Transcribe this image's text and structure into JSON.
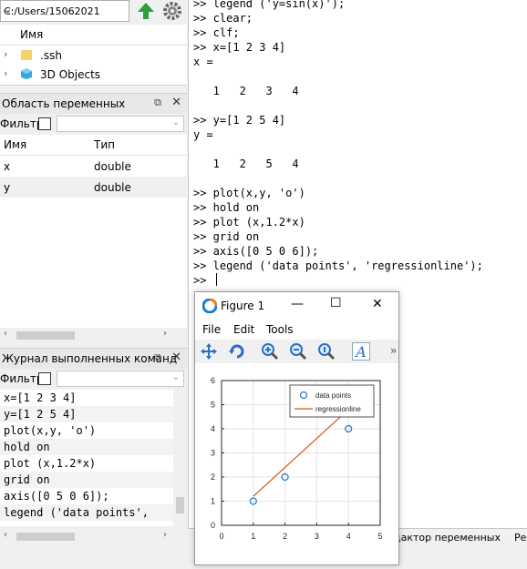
{
  "current_folder": {
    "path": "C:/Users/15062021"
  },
  "files": {
    "header_name": "Имя",
    "items": [
      {
        "name": ".ssh",
        "icon": "folder-icon"
      },
      {
        "name": "3D Objects",
        "icon": "3d-objects-icon"
      }
    ]
  },
  "workspace": {
    "title": "Область переменных",
    "filter_label": "Фильтр",
    "col_name": "Имя",
    "col_type": "Тип",
    "rows": [
      {
        "name": "x",
        "type": "double"
      },
      {
        "name": "y",
        "type": "double"
      }
    ]
  },
  "history": {
    "title": "Журнал выполненных команд",
    "filter_label": "Фильтр",
    "lines": [
      "x=[1 2 3 4]",
      "y=[1 2 5 4]",
      "plot(x,y, 'o')",
      "hold on",
      "plot (x,1.2*x)",
      "grid on",
      "axis([0 5 0 6]);",
      "legend ('data points',"
    ]
  },
  "command_window": {
    "lines": [
      ">> legend ('y=sin(x)');",
      ">> clear;",
      ">> clf;",
      ">> x=[1 2 3 4]",
      "x =",
      "",
      "   1   2   3   4",
      "",
      ">> y=[1 2 5 4]",
      "y =",
      "",
      "   1   2   5   4",
      "",
      ">> plot(x,y, 'o')",
      ">> hold on",
      ">> plot (x,1.2*x)",
      ">> grid on",
      ">> axis([0 5 0 6]);",
      ">> legend ('data points', 'regressionline');",
      ">> "
    ]
  },
  "bottom_tabs": {
    "variable_editor": "дактор переменных",
    "next": "Ре"
  },
  "figure": {
    "title": "Figure 1",
    "menu": [
      "File",
      "Edit",
      "Tools"
    ],
    "toolbar_more": "»",
    "colors": {
      "points": "#1f77d4",
      "line": "#d95319"
    }
  },
  "chart_data": {
    "type": "scatter",
    "x_ticks": [
      "0",
      "1",
      "2",
      "3",
      "4",
      "5"
    ],
    "y_ticks": [
      "0",
      "1",
      "2",
      "3",
      "4",
      "5",
      "6"
    ],
    "xlim": [
      0,
      5
    ],
    "ylim": [
      0,
      6
    ],
    "grid": true,
    "legend_position": "top-right",
    "series": [
      {
        "name": "data points",
        "style": "markers",
        "x": [
          1,
          2,
          3,
          4
        ],
        "y": [
          1,
          2,
          5,
          4
        ]
      },
      {
        "name": "regressionline",
        "style": "line",
        "x": [
          1,
          2,
          3,
          4
        ],
        "y": [
          1.2,
          2.4,
          3.6,
          4.8
        ]
      }
    ]
  }
}
